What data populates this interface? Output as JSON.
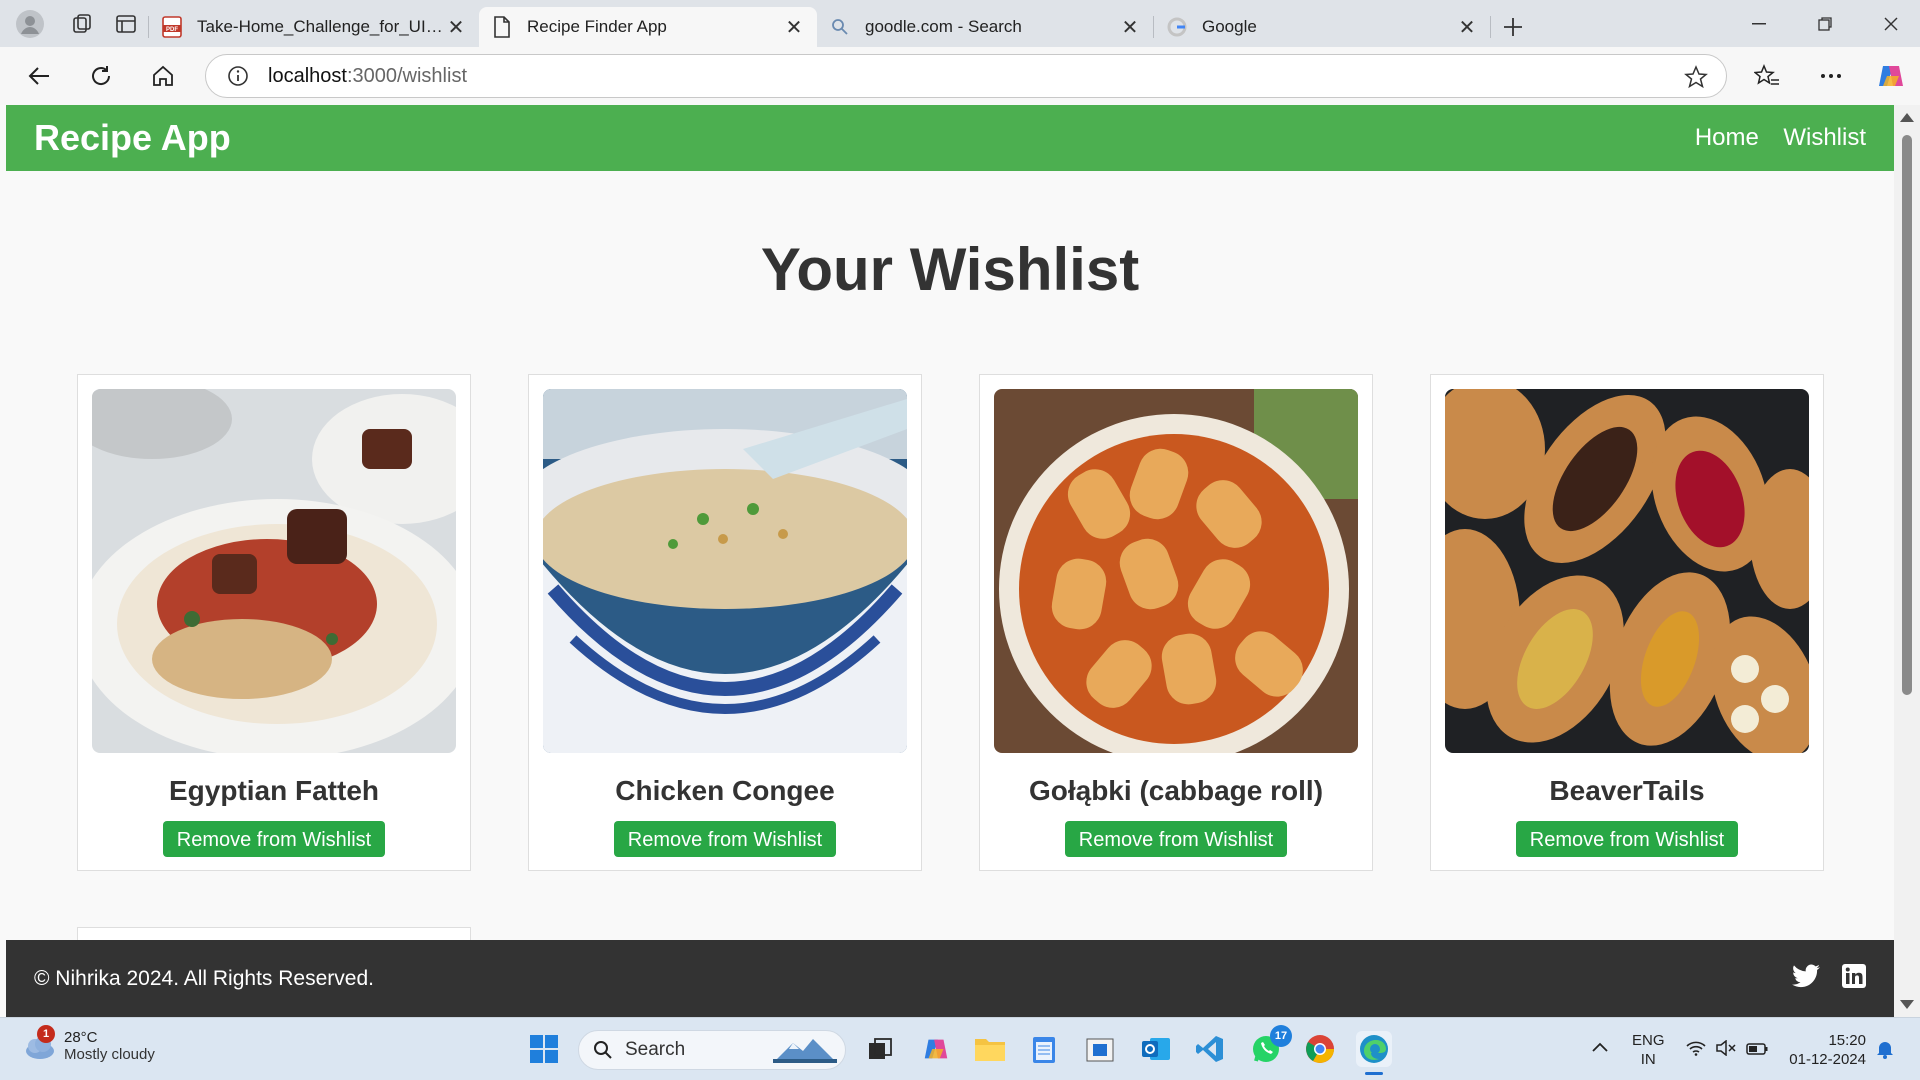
{
  "browser": {
    "tabs": [
      {
        "title": "Take-Home_Challenge_for_UI_(1)_",
        "icon": "pdf-icon",
        "active": false
      },
      {
        "title": "Recipe Finder App",
        "icon": "page-icon",
        "active": true
      },
      {
        "title": "goodle.com - Search",
        "icon": "search-icon",
        "active": false
      },
      {
        "title": "Google",
        "icon": "google-icon",
        "active": false
      }
    ],
    "url_host": "localhost",
    "url_path": ":3000/wishlist"
  },
  "site": {
    "brand": "Recipe App",
    "nav": [
      "Home",
      "Wishlist"
    ],
    "page_title": "Your Wishlist",
    "cards": [
      {
        "name": "Egyptian Fatteh",
        "button": "Remove from Wishlist"
      },
      {
        "name": "Chicken Congee",
        "button": "Remove from Wishlist"
      },
      {
        "name": "Gołąbki (cabbage roll)",
        "button": "Remove from Wishlist"
      },
      {
        "name": "BeaverTails",
        "button": "Remove from Wishlist"
      }
    ],
    "footer_text": "© Nihrika 2024. All Rights Reserved.",
    "social_icons": [
      "twitter-icon",
      "linkedin-icon"
    ]
  },
  "colors": {
    "header_green": "#4caf50",
    "button_green": "#28a745",
    "footer_dark": "#333333"
  },
  "taskbar": {
    "weather_temp": "28°C",
    "weather_desc": "Mostly cloudy",
    "weather_badge": "1",
    "search_label": "Search",
    "whatsapp_badge": "17",
    "lang_line1": "ENG",
    "lang_line2": "IN",
    "time": "15:20",
    "date": "01-12-2024"
  }
}
